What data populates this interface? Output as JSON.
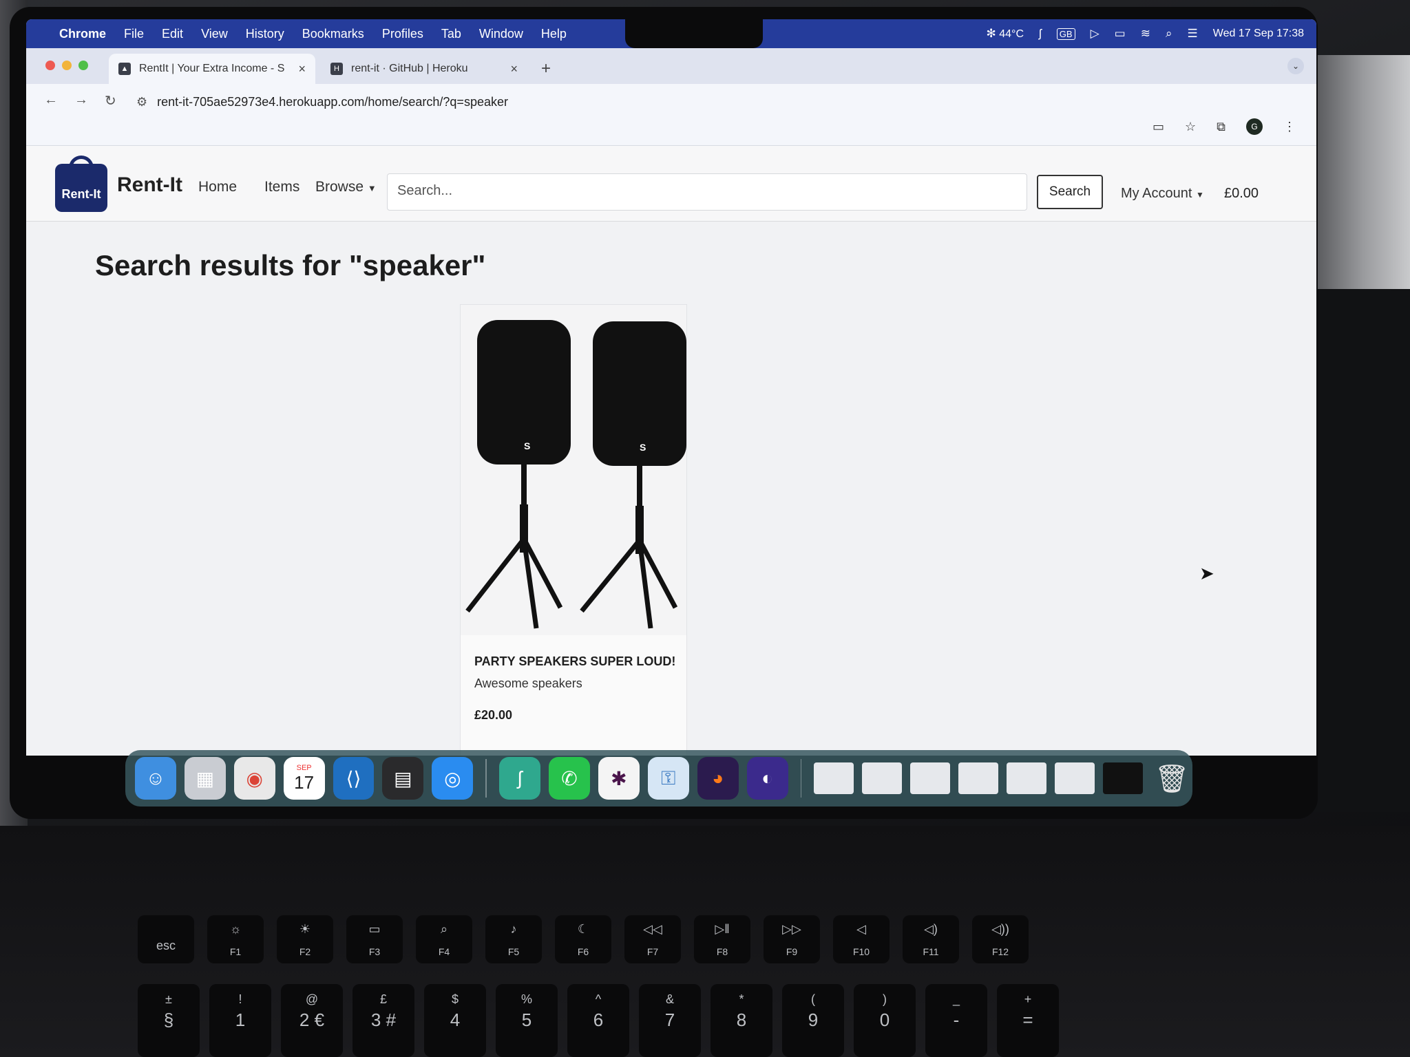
{
  "menubar": {
    "app": "Chrome",
    "items": [
      "File",
      "Edit",
      "View",
      "History",
      "Bookmarks",
      "Profiles",
      "Tab",
      "Window",
      "Help"
    ],
    "status": {
      "temperature": "44°C",
      "input": "GB",
      "datetime": "Wed 17 Sep  17:38"
    }
  },
  "tabs": [
    {
      "title": "RentIt | Your Extra Income - S",
      "active": true
    },
    {
      "title": "rent-it · GitHub | Heroku",
      "active": false
    }
  ],
  "address": {
    "url": "rent-it-705ae52973e4.herokuapp.com/home/search/?q=speaker"
  },
  "site": {
    "logo_text": "Rent-It",
    "brand": "Rent-It",
    "nav": {
      "home": "Home",
      "items": "Items",
      "browse": "Browse"
    },
    "search_placeholder": "Search...",
    "search_button": "Search",
    "account": "My Account",
    "cart_total": "£0.00"
  },
  "results": {
    "title": "Search results for \"speaker\"",
    "items": [
      {
        "name": "PARTY SPEAKERS SUPER LOUD!",
        "description": "Awesome speakers",
        "price": "£20.00"
      }
    ]
  },
  "dock": {
    "calendar_month": "SEP",
    "calendar_day": "17"
  },
  "keyboard": {
    "function_keys": [
      "esc",
      "F1",
      "F2",
      "F3",
      "F4",
      "F5",
      "F6",
      "F7",
      "F8",
      "F9",
      "F10",
      "F11",
      "F12"
    ],
    "number_keys": [
      {
        "top": "±",
        "bottom": "§"
      },
      {
        "top": "!",
        "bottom": "1"
      },
      {
        "top": "@",
        "bottom": "2 €"
      },
      {
        "top": "£",
        "bottom": "3 #"
      },
      {
        "top": "$",
        "bottom": "4"
      },
      {
        "top": "%",
        "bottom": "5"
      },
      {
        "top": "^",
        "bottom": "6"
      },
      {
        "top": "&",
        "bottom": "7"
      },
      {
        "top": "*",
        "bottom": "8"
      },
      {
        "top": "(",
        "bottom": "9"
      },
      {
        "top": ")",
        "bottom": "0"
      },
      {
        "top": "_",
        "bottom": "-"
      },
      {
        "top": "+",
        "bottom": "="
      }
    ]
  }
}
